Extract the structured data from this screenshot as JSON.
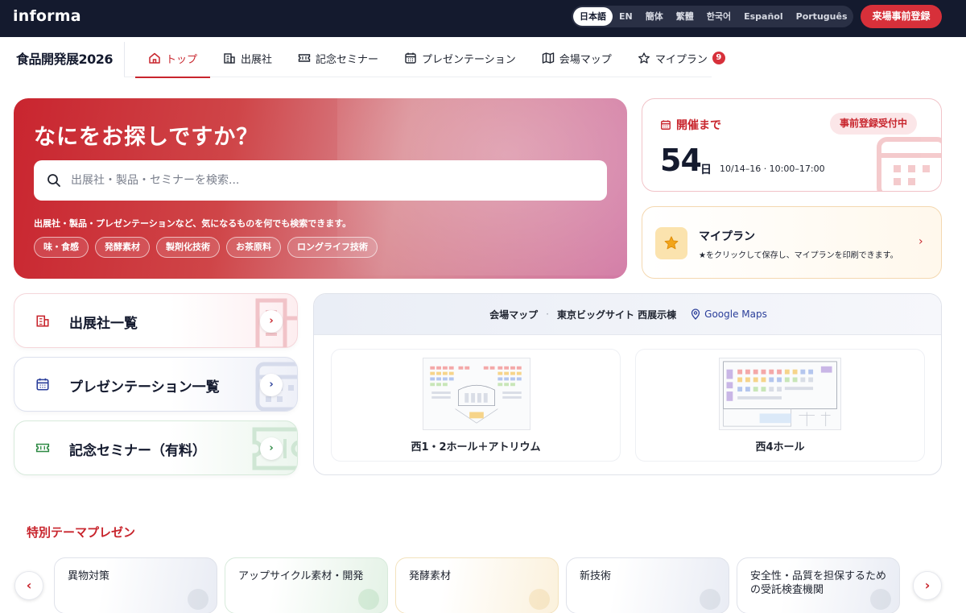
{
  "topbar": {
    "logo": "informa",
    "languages": [
      "日本語",
      "EN",
      "簡体",
      "繁體",
      "한국어",
      "Español",
      "Português"
    ],
    "active_language": "日本語",
    "prereg_button": "来場事前登録"
  },
  "nav": {
    "brand": "食品開発展2026",
    "items": [
      {
        "label": "トップ",
        "icon": "home-icon",
        "active": true
      },
      {
        "label": "出展社",
        "icon": "building-icon"
      },
      {
        "label": "記念セミナー",
        "icon": "ticket-icon"
      },
      {
        "label": "プレゼンテーション",
        "icon": "calendar-icon"
      },
      {
        "label": "会場マップ",
        "icon": "map-icon"
      },
      {
        "label": "マイプラン",
        "icon": "star-icon",
        "badge": "9"
      }
    ]
  },
  "hero": {
    "title": "なにをお探しですか？",
    "search_placeholder": "出展社・製品・セミナーを検索...",
    "hint": "出展社・製品・プレゼンテーションなど、気になるものを何でも検索できます。",
    "chips": [
      "味・食感",
      "発酵素材",
      "製剤化技術",
      "お茶原料",
      "ロングライフ技術"
    ]
  },
  "countdown": {
    "label": "開催まで",
    "badge": "事前登録受付中",
    "days": "54",
    "unit": "日",
    "dates": "10/14–16 · 10:00–17:00"
  },
  "myplan": {
    "title": "マイプラン",
    "description": "★をクリックして保存し、マイプランを印刷できます。"
  },
  "quick_links": [
    {
      "label": "出展社一覧",
      "icon": "building-icon"
    },
    {
      "label": "プレゼンテーション一覧",
      "icon": "calendar-icon"
    },
    {
      "label": "記念セミナー（有料）",
      "icon": "ticket-icon"
    }
  ],
  "venue": {
    "title": "会場マップ",
    "location": "東京ビッグサイト 西展示棟",
    "gmaps": "Google Maps",
    "halls": [
      "西1・2ホール＋アトリウム",
      "西4ホール"
    ]
  },
  "themes": {
    "title": "特別テーマプレゼン",
    "items": [
      "異物対策",
      "アップサイクル素材・開発",
      "発酵素材",
      "新技術",
      "安全性・品質を担保するための受託検査機関"
    ]
  },
  "colors": {
    "brand_red": "#c8252d",
    "topbar_navy": "#141a2e"
  }
}
